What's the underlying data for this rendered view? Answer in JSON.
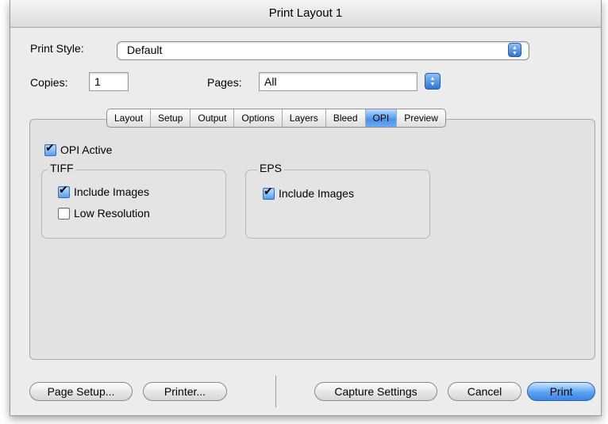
{
  "window": {
    "title": "Print Layout 1"
  },
  "print_style": {
    "label": "Print Style:",
    "value": "Default"
  },
  "copies": {
    "label": "Copies:",
    "value": "1"
  },
  "pages": {
    "label": "Pages:",
    "value": "All"
  },
  "tabs": [
    {
      "label": "Layout",
      "active": false
    },
    {
      "label": "Setup",
      "active": false
    },
    {
      "label": "Output",
      "active": false
    },
    {
      "label": "Options",
      "active": false
    },
    {
      "label": "Layers",
      "active": false
    },
    {
      "label": "Bleed",
      "active": false
    },
    {
      "label": "OPI",
      "active": true
    },
    {
      "label": "Preview",
      "active": false
    }
  ],
  "opi": {
    "active_label": "OPI Active",
    "active_checked": true,
    "tiff": {
      "title": "TIFF",
      "include_images": {
        "label": "Include Images",
        "checked": true
      },
      "low_resolution": {
        "label": "Low Resolution",
        "checked": false
      }
    },
    "eps": {
      "title": "EPS",
      "include_images": {
        "label": "Include Images",
        "checked": true
      }
    }
  },
  "buttons": {
    "page_setup": "Page Setup...",
    "printer": "Printer...",
    "capture_settings": "Capture Settings",
    "cancel": "Cancel",
    "print": "Print"
  },
  "colors": {
    "accent": "#4a94ec",
    "default_button": "#5aa2f2"
  }
}
